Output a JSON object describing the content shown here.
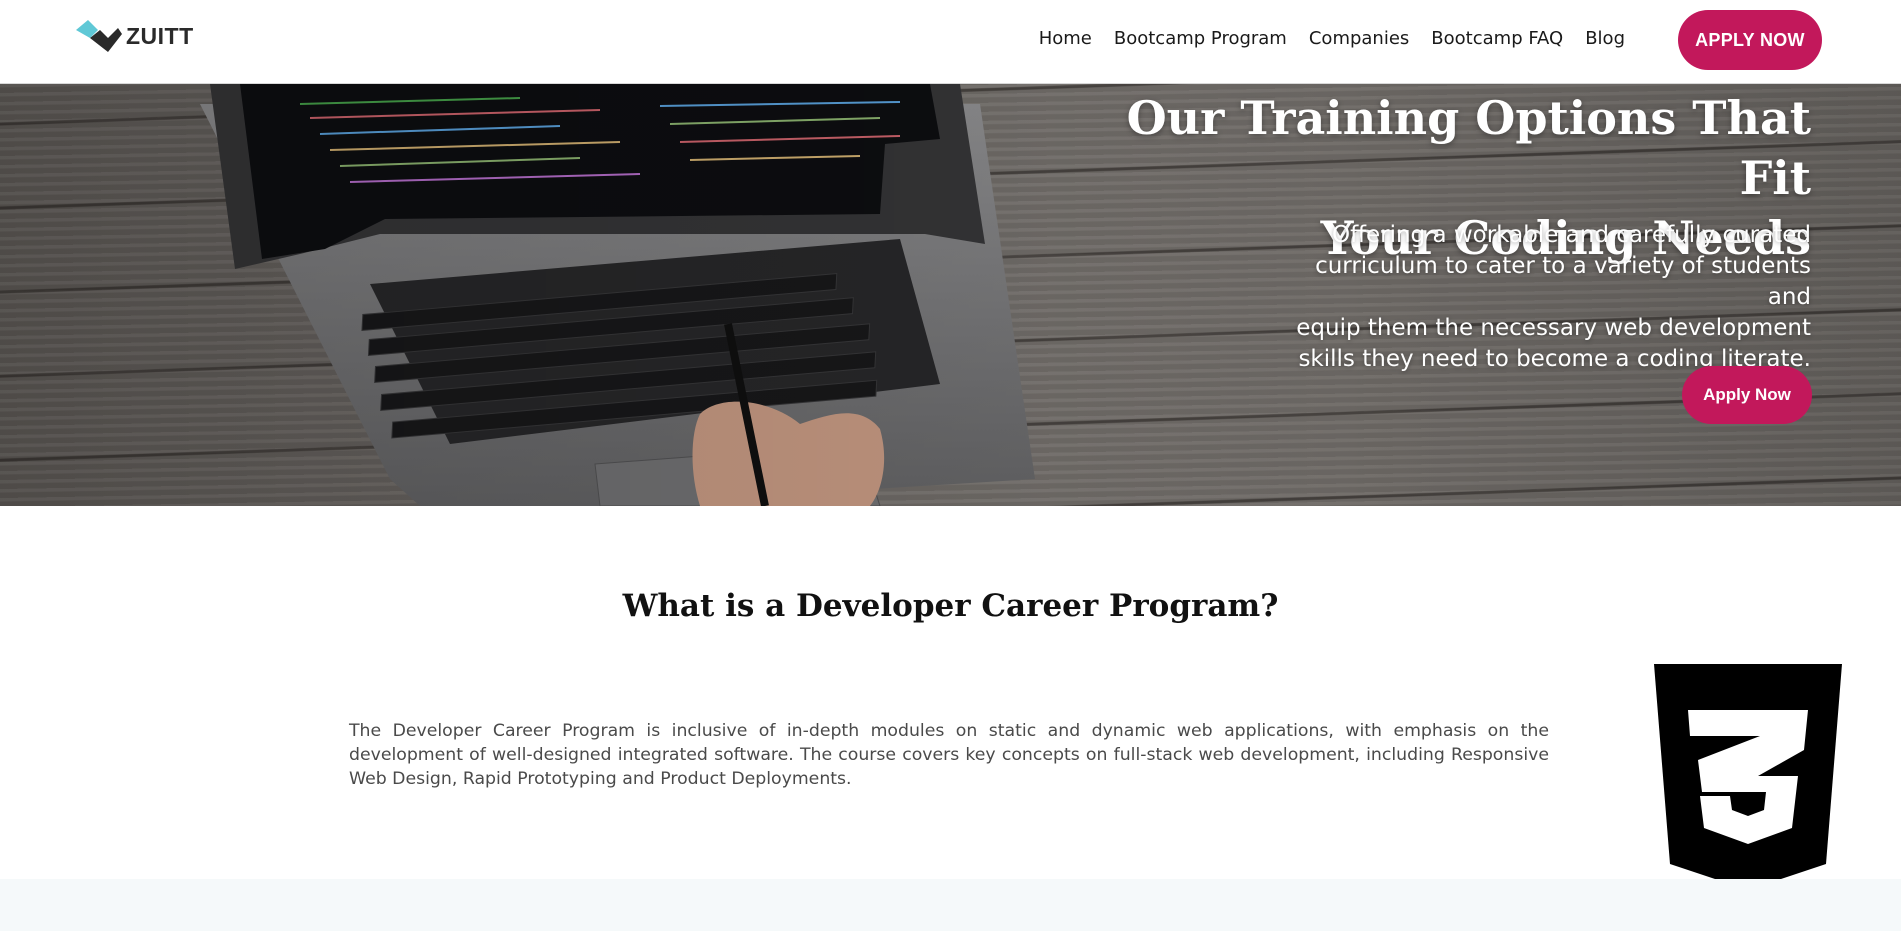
{
  "brand": {
    "name": "ZUITT"
  },
  "nav": {
    "links": [
      "Home",
      "Bootcamp Program",
      "Companies",
      "Bootcamp FAQ",
      "Blog"
    ],
    "apply_label": "APPLY NOW"
  },
  "hero": {
    "title_line1": "Our Training Options That Fit",
    "title_line2": "Your Coding Needs",
    "subtitle_lines": [
      "Offering a workable and carefully curated",
      "curriculum to cater to a variety of students and",
      "equip them the necessary web development",
      "skills they need to become a coding literate."
    ],
    "apply_label": "Apply Now"
  },
  "section": {
    "title": "What is a Developer Career Program?",
    "body": "The Developer Career Program is inclusive of in-depth modules on static and dynamic web applications, with emphasis on the development of well-designed integrated software. The course covers key concepts on full-stack web development, including Responsive Web Design, Rapid Prototyping and Product Deployments."
  },
  "icons": {
    "logo": "zuitt-logo-icon",
    "badge": "css3-icon"
  },
  "colors": {
    "accent": "#c2185b",
    "logo_teal": "#5fc8d6",
    "logo_dark": "#2a2a2a"
  }
}
